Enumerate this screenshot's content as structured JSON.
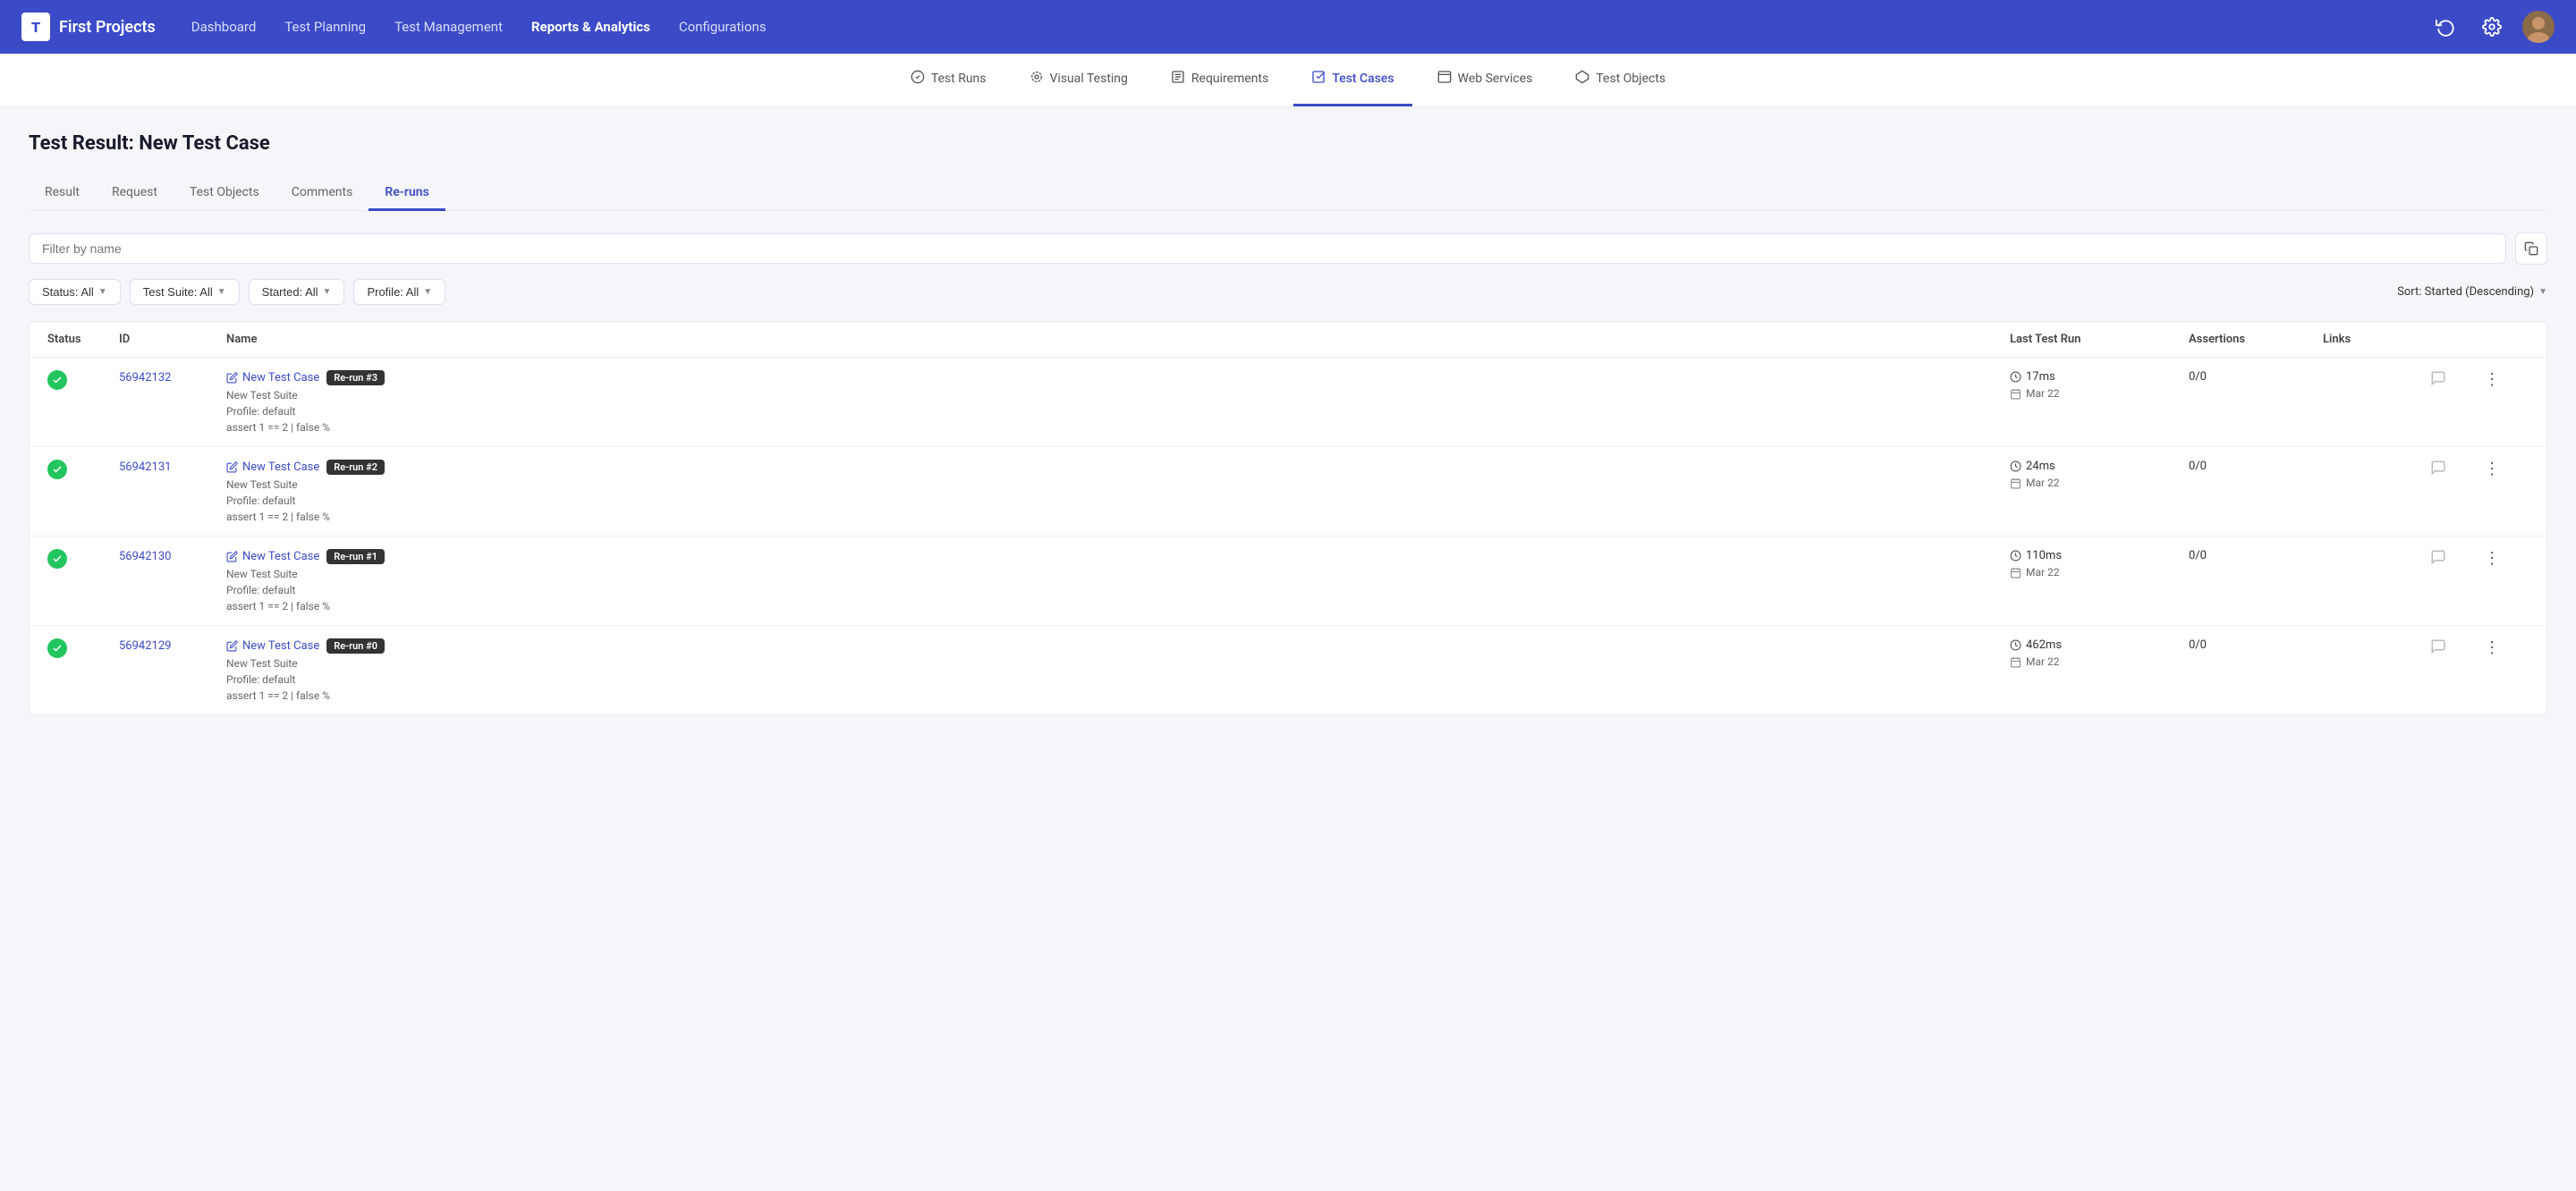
{
  "app": {
    "logo_letter": "T",
    "project_name": "First Projects"
  },
  "top_nav": {
    "links": [
      {
        "label": "Dashboard",
        "active": false
      },
      {
        "label": "Test Planning",
        "active": false
      },
      {
        "label": "Test Management",
        "active": false
      },
      {
        "label": "Reports & Analytics",
        "active": true
      },
      {
        "label": "Configurations",
        "active": false
      }
    ]
  },
  "sub_nav": {
    "items": [
      {
        "label": "Test Runs",
        "icon": "✓",
        "active": false
      },
      {
        "label": "Visual Testing",
        "icon": "◎",
        "active": false
      },
      {
        "label": "Requirements",
        "icon": "☰",
        "active": false
      },
      {
        "label": "Test Cases",
        "icon": "⬜",
        "active": true
      },
      {
        "label": "Web Services",
        "icon": "◻",
        "active": false
      },
      {
        "label": "Test Objects",
        "icon": "⬡",
        "active": false
      }
    ]
  },
  "page": {
    "title": "Test Result: New Test Case"
  },
  "tabs": [
    {
      "label": "Result",
      "active": false
    },
    {
      "label": "Request",
      "active": false
    },
    {
      "label": "Test Objects",
      "active": false
    },
    {
      "label": "Comments",
      "active": false
    },
    {
      "label": "Re-runs",
      "active": true
    }
  ],
  "search": {
    "placeholder": "Filter by name"
  },
  "filters": {
    "status": "Status: All",
    "test_suite": "Test Suite: All",
    "started": "Started: All",
    "profile": "Profile: All",
    "sort": "Sort: Started (Descending)"
  },
  "table": {
    "headers": [
      "Status",
      "ID",
      "Name",
      "Last Test Run",
      "Assertions",
      "Links",
      "",
      ""
    ],
    "rows": [
      {
        "status": "pass",
        "id": "56942132",
        "name": "New Test Case",
        "suite": "New Test Suite",
        "profile": "Profile: default",
        "assert": "assert 1 == 2  |  false  %",
        "badge": "Re-run #3",
        "time": "17ms",
        "date": "Mar 22",
        "assertions": "0/0"
      },
      {
        "status": "pass",
        "id": "56942131",
        "name": "New Test Case",
        "suite": "New Test Suite",
        "profile": "Profile: default",
        "assert": "assert 1 == 2  |  false  %",
        "badge": "Re-run #2",
        "time": "24ms",
        "date": "Mar 22",
        "assertions": "0/0"
      },
      {
        "status": "pass",
        "id": "56942130",
        "name": "New Test Case",
        "suite": "New Test Suite",
        "profile": "Profile: default",
        "assert": "assert 1 == 2  |  false  %",
        "badge": "Re-run #1",
        "time": "110ms",
        "date": "Mar 22",
        "assertions": "0/0"
      },
      {
        "status": "pass",
        "id": "56942129",
        "name": "New Test Case",
        "suite": "New Test Suite",
        "profile": "Profile: default",
        "assert": "assert 1 == 2  |  false  %",
        "badge": "Re-run #0",
        "time": "462ms",
        "date": "Mar 22",
        "assertions": "0/0"
      }
    ]
  }
}
